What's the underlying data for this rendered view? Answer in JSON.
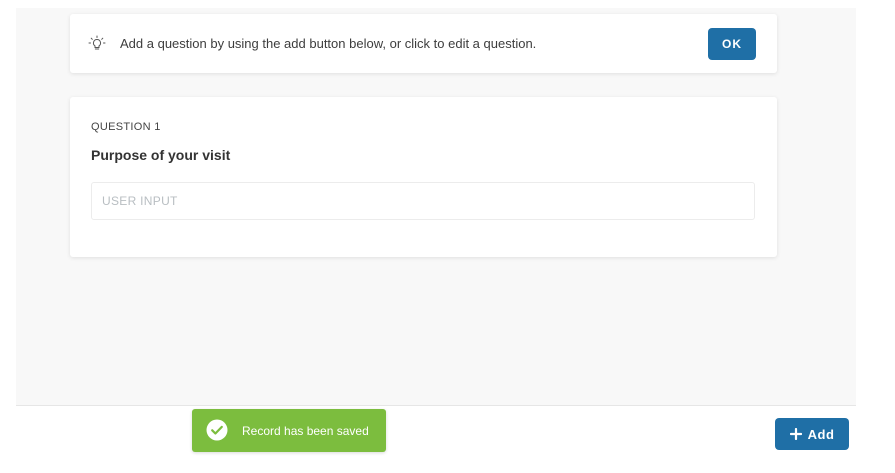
{
  "tip": {
    "icon": "lightbulb-icon",
    "text": "Add a question by using the add button below, or click to edit a question.",
    "ok_label": "OK"
  },
  "question": {
    "number_label": "QUESTION 1",
    "title": "Purpose of your visit",
    "input_placeholder": "USER INPUT",
    "input_value": ""
  },
  "toast": {
    "icon": "check-circle-icon",
    "message": "Record has been saved"
  },
  "footer": {
    "add_icon": "plus-icon",
    "add_label": "Add"
  },
  "colors": {
    "primary": "#1f6fa6",
    "success": "#7cbd3e",
    "canvas_bg": "#f8f8f8"
  }
}
